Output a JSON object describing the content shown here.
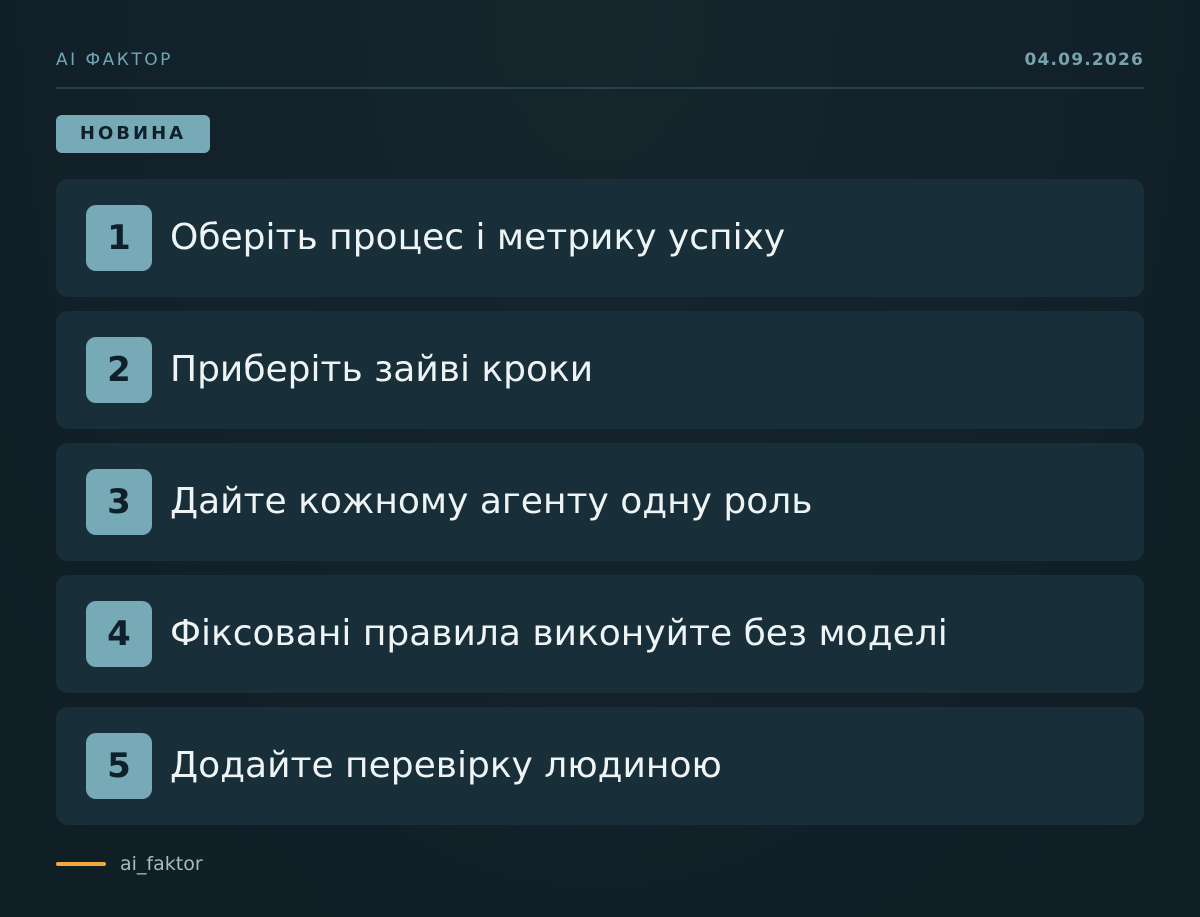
{
  "header": {
    "brand": "AI ФАКТОР",
    "date": "04.09.2026"
  },
  "badge": {
    "label": "НОВИНА"
  },
  "steps": [
    {
      "number": "1",
      "text": "Оберіть процес і метрику успіху"
    },
    {
      "number": "2",
      "text": "Приберіть зайві кроки"
    },
    {
      "number": "3",
      "text": "Дайте кожному агенту одну роль"
    },
    {
      "number": "4",
      "text": "Фіксовані правила виконуйте без моделі"
    },
    {
      "number": "5",
      "text": "Додайте перевірку людиною"
    }
  ],
  "footer": {
    "handle": "ai_faktor"
  },
  "colors": {
    "background": "#122129",
    "card": "#182e38",
    "accent": "#76aab7",
    "footer_line": "#f0a93a"
  }
}
